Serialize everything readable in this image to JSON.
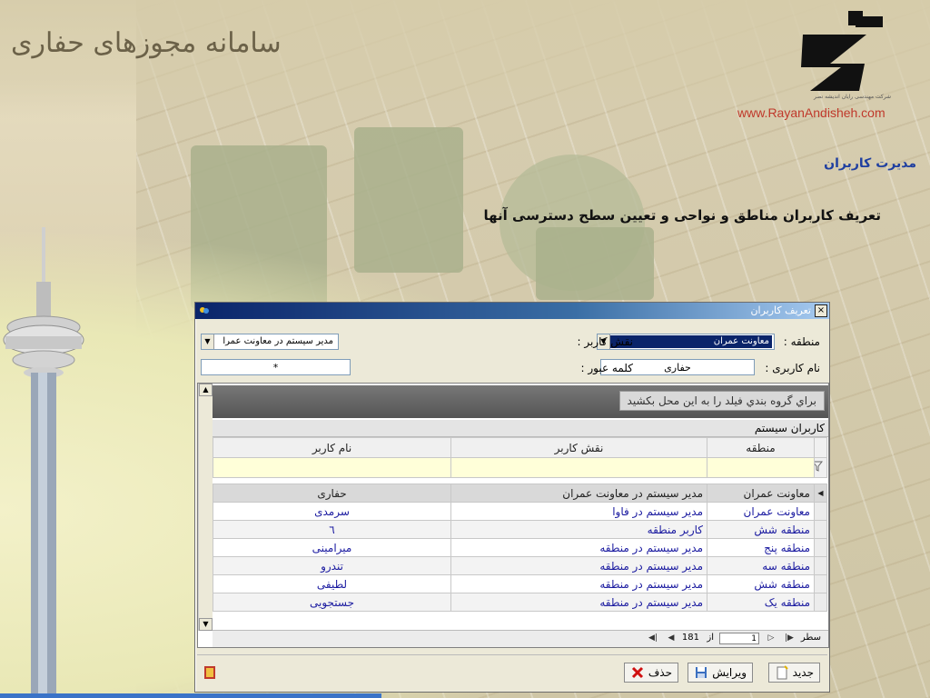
{
  "header": {
    "app_title": "سامانه مجوزهای حفاری",
    "website": "www.RayanAndisheh.com",
    "logo_subtitle": "شرکت مهندسی رایان اندیشه نصر"
  },
  "page": {
    "section_title": "مدیرت کاربران",
    "description": "تعریف کاربران مناطق و نواحی و تعیین سطح دسترسی آنها"
  },
  "dialog": {
    "title": "تعریف کاربران",
    "close_glyph": "×",
    "form": {
      "region_label": "منطقه :",
      "region_value": "معاونت عمران",
      "role_label": "نقش کاربر :",
      "role_value": "مدیر سیستم در معاونت عمرا",
      "username_label": "نام کاربری :",
      "username_value": "حفاری",
      "password_label": "کلمه عبور :",
      "password_value": "*"
    },
    "grid": {
      "group_hint": "براي گروه بندي فيلد را به اين محل بكشيد",
      "caption": "کاربران سیستم",
      "columns": [
        "منطقه",
        "نقش کاربر",
        "نام کاربر"
      ],
      "rows": [
        {
          "region": "معاونت عمران",
          "role": "مدیر سیستم در معاونت عمران",
          "name": "حفاری"
        },
        {
          "region": "معاونت عمران",
          "role": "مدیر سیستم در فاوا",
          "name": "سرمدی"
        },
        {
          "region": "منطقه شش",
          "role": "کاربر منطقه",
          "name": "٦"
        },
        {
          "region": "منطقه پنج",
          "role": "مدیر سیستم در منطقه",
          "name": "میرامینی"
        },
        {
          "region": "منطقه سه",
          "role": "مدیر سیستم در منطقه",
          "name": "تندرو"
        },
        {
          "region": "منطقه شش",
          "role": "مدیر سیستم در منطقه",
          "name": "لطیفی"
        },
        {
          "region": "منطقه یک",
          "role": "مدیر سیستم در منطقه",
          "name": "جستجویی"
        }
      ],
      "pager": {
        "row_label": "سطر",
        "current": "1",
        "of_label": "از",
        "total": "181"
      }
    },
    "buttons": {
      "new": "جدید",
      "edit": "ویرایش",
      "delete": "حذف"
    }
  },
  "colors": {
    "accent": "#1f3fa0",
    "url": "#c0392b",
    "titlebar": "#0a246a"
  }
}
